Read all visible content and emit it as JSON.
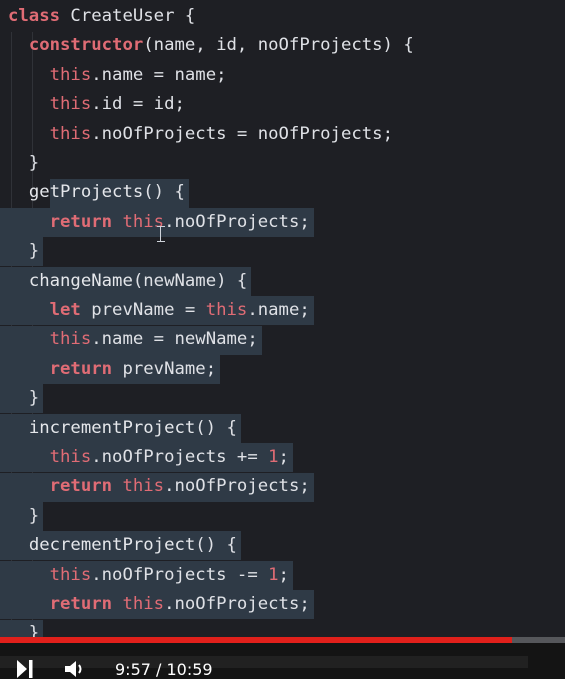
{
  "code": {
    "lines": [
      [
        [
          "kw",
          "class"
        ],
        [
          "p",
          " CreateUser {"
        ]
      ],
      [
        [
          "p",
          "  "
        ],
        [
          "kw",
          "constructor"
        ],
        [
          "p",
          "(name, id, noOfProjects) {"
        ]
      ],
      [
        [
          "p",
          "    "
        ],
        [
          "th",
          "this"
        ],
        [
          "p",
          ".name = name;"
        ]
      ],
      [
        [
          "p",
          "    "
        ],
        [
          "th",
          "this"
        ],
        [
          "p",
          ".id = id;"
        ]
      ],
      [
        [
          "p",
          "    "
        ],
        [
          "th",
          "this"
        ],
        [
          "p",
          ".noOfProjects = noOfProjects;"
        ]
      ],
      [
        [
          "p",
          "  }"
        ]
      ],
      [
        [
          "p",
          "  "
        ],
        [
          "fn",
          "getProjects"
        ],
        [
          "p",
          "() {"
        ]
      ],
      [
        [
          "p",
          "    "
        ],
        [
          "kw",
          "return"
        ],
        [
          "p",
          " "
        ],
        [
          "th",
          "this"
        ],
        [
          "p",
          ".noOfProjects;"
        ]
      ],
      [
        [
          "p",
          "  }"
        ]
      ],
      [
        [
          "p",
          "  "
        ],
        [
          "fn",
          "changeName"
        ],
        [
          "p",
          "(newName) {"
        ]
      ],
      [
        [
          "p",
          "    "
        ],
        [
          "kw",
          "let"
        ],
        [
          "p",
          " prevName = "
        ],
        [
          "th",
          "this"
        ],
        [
          "p",
          ".name;"
        ]
      ],
      [
        [
          "p",
          "    "
        ],
        [
          "th",
          "this"
        ],
        [
          "p",
          ".name = newName;"
        ]
      ],
      [
        [
          "p",
          "    "
        ],
        [
          "kw",
          "return"
        ],
        [
          "p",
          " prevName;"
        ]
      ],
      [
        [
          "p",
          "  }"
        ]
      ],
      [
        [
          "p",
          "  "
        ],
        [
          "fn",
          "incrementProject"
        ],
        [
          "p",
          "() {"
        ]
      ],
      [
        [
          "p",
          "    "
        ],
        [
          "th",
          "this"
        ],
        [
          "p",
          ".noOfProjects += "
        ],
        [
          "nm",
          "1"
        ],
        [
          "p",
          ";"
        ]
      ],
      [
        [
          "p",
          "    "
        ],
        [
          "kw",
          "return"
        ],
        [
          "p",
          " "
        ],
        [
          "th",
          "this"
        ],
        [
          "p",
          ".noOfProjects;"
        ]
      ],
      [
        [
          "p",
          "  }"
        ]
      ],
      [
        [
          "p",
          "  "
        ],
        [
          "fn",
          "decrementProject"
        ],
        [
          "p",
          "() {"
        ]
      ],
      [
        [
          "p",
          "    "
        ],
        [
          "th",
          "this"
        ],
        [
          "p",
          ".noOfProjects -= "
        ],
        [
          "nm",
          "1"
        ],
        [
          "p",
          ";"
        ]
      ],
      [
        [
          "p",
          "    "
        ],
        [
          "kw",
          "return"
        ],
        [
          "p",
          " "
        ],
        [
          "th",
          "this"
        ],
        [
          "p",
          ".noOfProjects;"
        ]
      ],
      [
        [
          "p",
          "  }"
        ]
      ]
    ],
    "selected_lines": [
      6,
      7,
      8,
      9,
      10,
      11,
      12,
      13,
      14,
      15,
      16,
      17,
      18,
      19,
      20,
      21
    ]
  },
  "player": {
    "time_display": "9:57 / 10:59",
    "progress_fraction": 0.906,
    "accent_color": "#e0201b",
    "play_icon": "play-pause-icon",
    "volume_icon": "volume-icon"
  },
  "colors": {
    "background": "#1e1f24",
    "keyword": "#e06c75",
    "text": "#dfe1e6",
    "selection": "#2f3a46"
  }
}
